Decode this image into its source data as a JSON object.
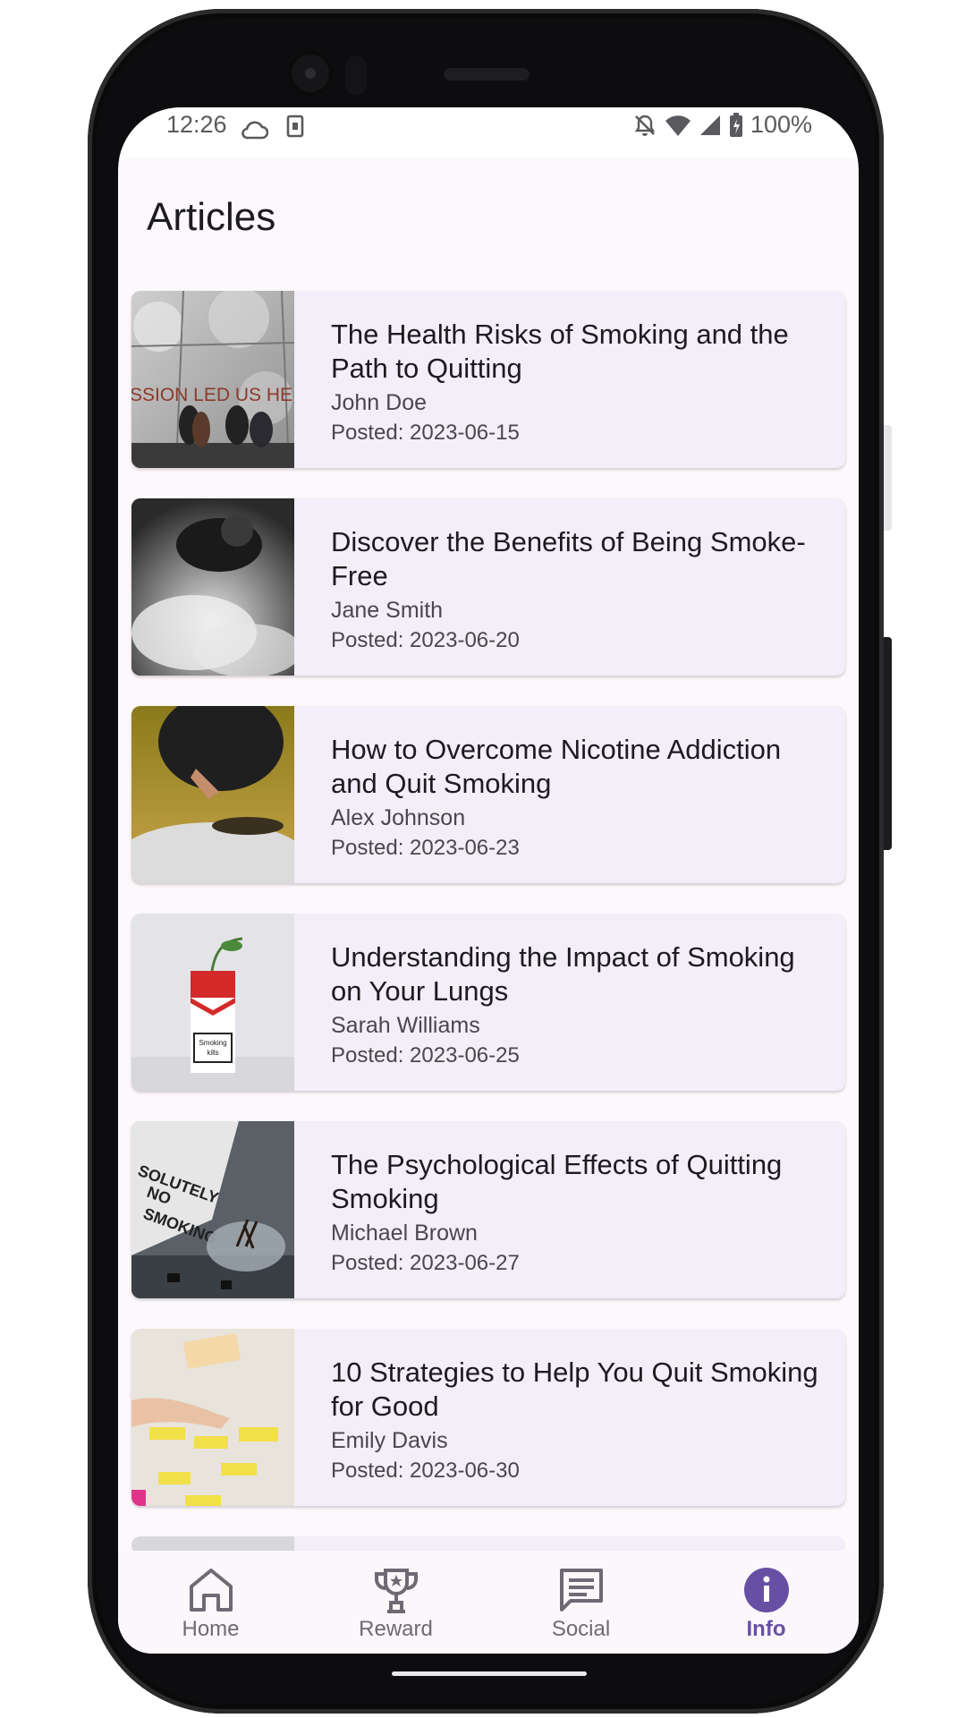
{
  "status_bar": {
    "time": "12:26",
    "battery": "100%"
  },
  "header": {
    "title": "Articles"
  },
  "articles": [
    {
      "title": "The Health Risks of Smoking and the Path to Quitting",
      "author": "John Doe",
      "date": "Posted: 2023-06-15",
      "thumb_text": "SSION LED US HE"
    },
    {
      "title": "Discover the Benefits of Being Smoke-Free",
      "author": "Jane Smith",
      "date": "Posted: 2023-06-20"
    },
    {
      "title": "How to Overcome Nicotine Addiction and Quit Smoking",
      "author": "Alex Johnson",
      "date": "Posted: 2023-06-23"
    },
    {
      "title": "Understanding the Impact of Smoking on Your Lungs",
      "author": "Sarah Williams",
      "date": "Posted: 2023-06-25",
      "thumb_text": "Smoking kills"
    },
    {
      "title": "The Psychological Effects of Quitting Smoking",
      "author": "Michael Brown",
      "date": "Posted: 2023-06-27",
      "thumb_text": "SOLUTELY NO SMOKING"
    },
    {
      "title": "10 Strategies to Help You Quit Smoking for Good",
      "author": "Emily Davis",
      "date": "Posted: 2023-06-30"
    }
  ],
  "bottom_nav": {
    "items": [
      {
        "label": "Home",
        "icon": "home-icon"
      },
      {
        "label": "Reward",
        "icon": "trophy-icon"
      },
      {
        "label": "Social",
        "icon": "chat-icon"
      },
      {
        "label": "Info",
        "icon": "info-icon",
        "active": true
      }
    ]
  },
  "colors": {
    "accent": "#6750a4",
    "card_bg": "#f3eef7",
    "screen_bg": "#fcf8fc"
  }
}
